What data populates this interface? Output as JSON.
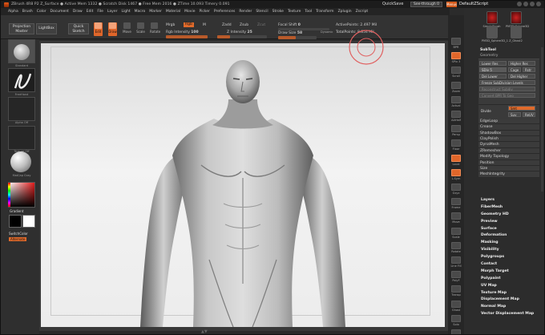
{
  "titlebar": {
    "text": "ZBrush 4R8 P2   Z_Surface   ● Active Mem 1332 ● Scratch Disk 1467 ● Free Mem 2016 ● ZTime 10.093 Timery 0.091",
    "quicksave": "QuickSave",
    "seethrough": "See-through 0",
    "menus": "Menus",
    "default_script": "DefaultZScript"
  },
  "menubar": [
    "Alpha",
    "Brush",
    "Color",
    "Document",
    "Draw",
    "Edit",
    "File",
    "Layer",
    "Light",
    "Macro",
    "Marker",
    "Material",
    "Movie",
    "Picker",
    "Preferences",
    "Render",
    "Stencil",
    "Stroke",
    "Texture",
    "Tool",
    "Transform",
    "Zplugin",
    "Zscript"
  ],
  "toolbar": {
    "projection_master": "Projection Master",
    "lightbox": "LightBox",
    "quick_sketch": "Quick Sketch",
    "edit": "Edit",
    "draw": "Draw",
    "move": "Move",
    "scale": "Scale",
    "rotate": "Rotate",
    "mrgb": "Mrgb",
    "rgb": "Rgb",
    "m": "M",
    "rgb_intensity_label": "Rgb Intensity",
    "rgb_intensity_value": "100",
    "zadd": "Zadd",
    "zsub": "Zsub",
    "zcut": "Zcut",
    "z_intensity_label": "Z Intensity",
    "z_intensity_value": "25",
    "focal_shift_label": "Focal Shift",
    "focal_shift_value": "0",
    "draw_size_label": "Draw Size",
    "draw_size_value": "58",
    "dynamic": "Dynamic",
    "active_points_label": "ActivePoints:",
    "active_points_value": "2.497 Mil",
    "total_points_label": "TotalPoints:",
    "total_points_value": "8.854 Mil",
    "rgb_intensity_fill": 1.0,
    "z_intensity_fill": 0.25,
    "draw_size_fill": 0.45
  },
  "leftshelf": {
    "brush_label": "Standard",
    "stroke_label": "FreeHand",
    "alpha_label": "Alpha Off",
    "texture_label": "Texture Off",
    "material_label": "MatCap Gray",
    "gradient": "Gradient",
    "switch_color": "SwitchColor",
    "alternate": "Alternate"
  },
  "rightshelf": [
    {
      "name": "bpr",
      "label": "BPR"
    },
    {
      "name": "spix",
      "label": "SPix 3"
    },
    {
      "name": "scroll",
      "label": "Scroll"
    },
    {
      "name": "zoom",
      "label": "Zoom"
    },
    {
      "name": "actual",
      "label": "Actual"
    },
    {
      "name": "aahalf",
      "label": "AAHalf"
    },
    {
      "name": "persp",
      "label": "Persp"
    },
    {
      "name": "floor",
      "label": "Floor"
    },
    {
      "name": "local",
      "label": "Local"
    },
    {
      "name": "lsym",
      "label": "L.Sym"
    },
    {
      "name": "gxyz",
      "label": "Gxyz"
    },
    {
      "name": "frame",
      "label": "Frame"
    },
    {
      "name": "move",
      "label": "Move"
    },
    {
      "name": "scale",
      "label": "Scale"
    },
    {
      "name": "rotate",
      "label": "Rotate"
    },
    {
      "name": "linefill",
      "label": "Line Fill"
    },
    {
      "name": "polyf",
      "label": "PolyF"
    },
    {
      "name": "transp",
      "label": "Transp"
    },
    {
      "name": "ghost",
      "label": "Ghost"
    },
    {
      "name": "solo",
      "label": "Solo"
    },
    {
      "name": "xpose",
      "label": "Xpose"
    }
  ],
  "rightpanel": {
    "tools": [
      {
        "label": "SimpleBrush"
      },
      {
        "label": "PM3D_Sphere3D"
      },
      {
        "label": "PM3D_Sphere3D_1"
      },
      {
        "label": "Z_Ghost2"
      }
    ],
    "subtool": "SubTool",
    "geometry": "Geometry",
    "lower_res": "Lower Res",
    "higher_res": "Higher Res",
    "sdiv_label": "SDiv",
    "sdiv_value": "5",
    "cage": "Cage",
    "rstr": "Rstr",
    "del_lower": "Del Lower",
    "del_higher": "Del Higher",
    "freeze_subdivision": "Freeze SubDivision Levels",
    "reconstruct_subdiv": "Reconstruct Subdiv",
    "convert_bpr": "Convert BPR To Geo",
    "divide": "Divide",
    "smt": "Smt",
    "suv": "Suv",
    "reuv": "ReUV",
    "items": [
      "EdgeLoop",
      "Crease",
      "ShadowBox",
      "ClayPolish",
      "DynaMesh",
      "ZRemesher",
      "Modify Topology",
      "Position",
      "Size",
      "MeshIntegrity"
    ],
    "lower_items": [
      "Layers",
      "FiberMesh",
      "Geometry HD",
      "Preview",
      "Surface",
      "Deformation",
      "Masking",
      "Visibility",
      "Polygroups",
      "Contact",
      "Morph Target",
      "Polypaint",
      "UV Map",
      "Texture Map",
      "Displacement Map",
      "Normal Map",
      "Vector Displacement Map"
    ]
  },
  "colors": {
    "accent": "#e0662a",
    "panel": "#2c2c2c",
    "canvas": "#eeeeee",
    "brush_ring": "#e06060"
  }
}
